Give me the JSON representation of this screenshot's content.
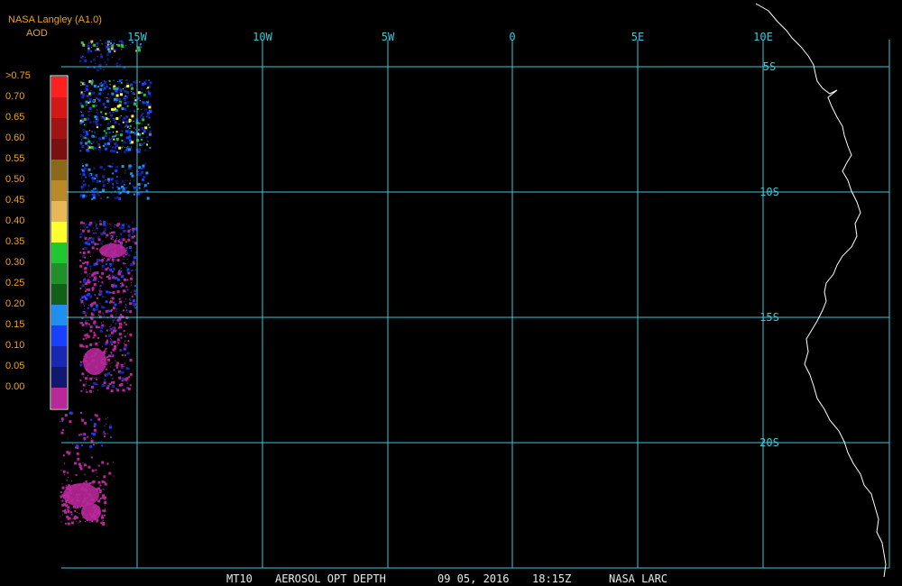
{
  "header": {
    "source": "NASA Langley (A1.0)",
    "unit": "AOD"
  },
  "colors": {
    "grid": "#3ec8d8",
    "coast": "#ffffff",
    "legend_text": "#f0a020"
  },
  "legend": {
    "bins": [
      {
        "label": ">0.75",
        "color": "#ff2020"
      },
      {
        "label": "0.70",
        "color": "#d41818"
      },
      {
        "label": "0.65",
        "color": "#a01414"
      },
      {
        "label": "0.60",
        "color": "#7a1010"
      },
      {
        "label": "0.55",
        "color": "#8a6a18"
      },
      {
        "label": "0.50",
        "color": "#b88a28"
      },
      {
        "label": "0.45",
        "color": "#e8b858"
      },
      {
        "label": "0.40",
        "color": "#ffff30"
      },
      {
        "label": "0.35",
        "color": "#20c830"
      },
      {
        "label": "0.30",
        "color": "#209028"
      },
      {
        "label": "0.25",
        "color": "#126018"
      },
      {
        "label": "0.20",
        "color": "#2090f0"
      },
      {
        "label": "0.15",
        "color": "#1840ff"
      },
      {
        "label": "0.10",
        "color": "#1828b0"
      },
      {
        "label": "0.05",
        "color": "#101870"
      },
      {
        "label": "0.00",
        "color": "#b82898"
      }
    ]
  },
  "map": {
    "lon_labels": [
      "15W",
      "10W",
      "5W",
      "0",
      "5E",
      "10E"
    ],
    "lat_labels": [
      "5S",
      "10S",
      "15S",
      "20S"
    ]
  },
  "footer": {
    "product": "MT10",
    "title": "AEROSOL OPT DEPTH",
    "date": "09 05, 2016",
    "time": "18:15Z",
    "agency": "NASA LARC"
  }
}
